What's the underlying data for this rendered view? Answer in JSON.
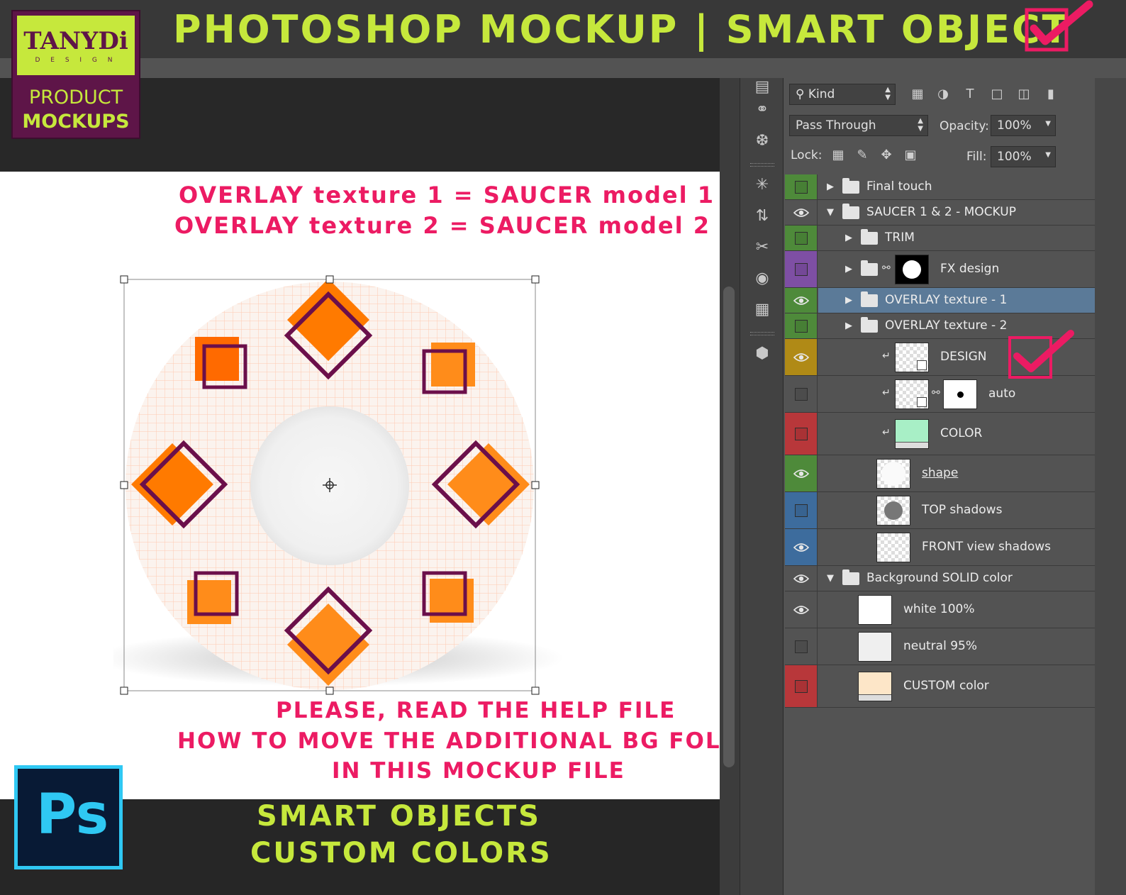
{
  "banner": {
    "title": "PHOTOSHOP MOCKUP | SMART OBJECT"
  },
  "logo": {
    "brand": "TANYDi",
    "sub": "D E S I G N",
    "product": "PRODUCT",
    "mockups": "MOCKUPS"
  },
  "canvas": {
    "overlay_line1": "OVERLAY texture 1 = SAUCER model 1",
    "overlay_line2": "OVERLAY texture 2 = SAUCER model 2",
    "help_line1": "PLEASE, READ THE HELP FILE",
    "help_line2": "HOW TO MOVE THE ADDITIONAL BG FOLDER",
    "help_line3": "IN THIS MOCKUP FILE",
    "bottom_line1": "SMART OBJECTS",
    "bottom_line2": "CUSTOM COLORS"
  },
  "ps_icon": {
    "label": "Ps"
  },
  "colors": {
    "accent_green": "#c6e83c",
    "accent_pink": "#ec1b63",
    "logo_purple": "#5e1548",
    "ps_blue": "#2fc8f3"
  },
  "layers_panel": {
    "filter_kind": "Kind",
    "blend_mode": "Pass Through",
    "opacity_label": "Opacity:",
    "opacity_value": "100%",
    "lock_label": "Lock:",
    "fill_label": "Fill:",
    "fill_value": "100%",
    "layers": [
      {
        "name": "Final touch",
        "tag": "green",
        "visible": false
      },
      {
        "name": "SAUCER 1 & 2 - MOCKUP",
        "tag": "none",
        "visible": true
      },
      {
        "name": "TRIM",
        "tag": "green",
        "visible": false
      },
      {
        "name": "FX design",
        "tag": "violet",
        "visible": false
      },
      {
        "name": "OVERLAY texture - 1",
        "tag": "green",
        "visible": true,
        "selected": true
      },
      {
        "name": "OVERLAY texture - 2",
        "tag": "green",
        "visible": false
      },
      {
        "name": "DESIGN",
        "tag": "yellow",
        "visible": true
      },
      {
        "name": "auto",
        "tag": "none",
        "visible": false
      },
      {
        "name": "COLOR",
        "tag": "red",
        "visible": false
      },
      {
        "name": "shape",
        "tag": "green",
        "visible": true
      },
      {
        "name": "TOP shadows",
        "tag": "blue",
        "visible": false
      },
      {
        "name": "FRONT view shadows",
        "tag": "blue",
        "visible": true
      },
      {
        "name": "Background SOLID color",
        "tag": "none",
        "visible": true
      },
      {
        "name": "white 100%",
        "tag": "none",
        "visible": true
      },
      {
        "name": "neutral 95%",
        "tag": "none",
        "visible": false
      },
      {
        "name": "CUSTOM color",
        "tag": "red",
        "visible": false
      }
    ]
  }
}
